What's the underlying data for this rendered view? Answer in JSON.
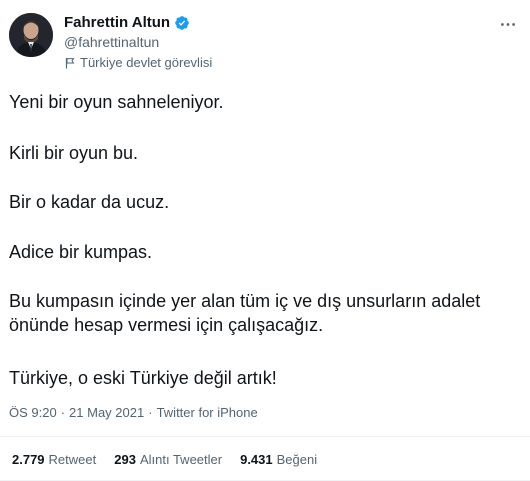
{
  "author": {
    "name": "Fahrettin Altun",
    "handle": "@fahrettinaltun",
    "label": "Türkiye devlet görevlisi",
    "verified_color": "#1d9bf0"
  },
  "icons": {
    "verified": "verified-badge-icon",
    "flag": "flag-icon",
    "more": "more-icon"
  },
  "tweet": {
    "paragraphs": [
      "Yeni bir oyun sahneleniyor.",
      "Kirli bir oyun bu.",
      "Bir o kadar da ucuz.",
      "Adice bir kumpas.",
      "Bu kumpasın içinde yer alan tüm iç ve dış unsurların adalet önünde hesap vermesi için çalışacağız.",
      "Türkiye, o eski Türkiye değil artık!"
    ],
    "time": "ÖS 9:20",
    "separator": "·",
    "date": "21 May 2021",
    "source": "Twitter for iPhone"
  },
  "stats": [
    {
      "count": "2.779",
      "label": "Retweet"
    },
    {
      "count": "293",
      "label": "Alıntı Tweetler"
    },
    {
      "count": "9.431",
      "label": "Beğeni"
    }
  ]
}
